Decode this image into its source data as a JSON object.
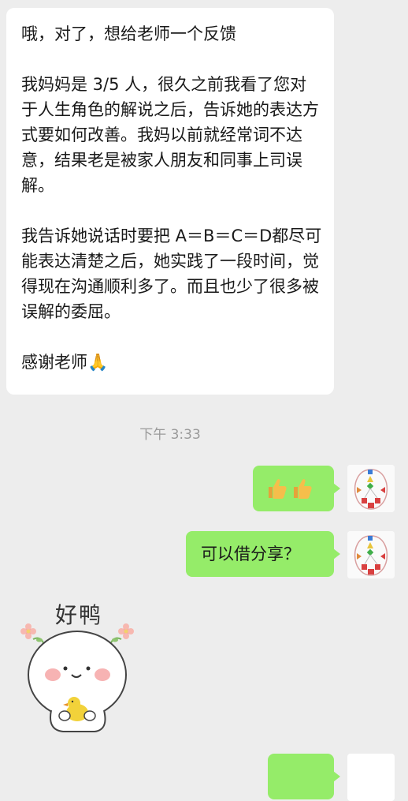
{
  "incoming_message": {
    "line1": "哦，对了，想给老师一个反馈",
    "para2": "我妈妈是 3/5 人，很久之前我看了您对于人生角色的解说之后，告诉她的表达方式要如何改善。我妈以前就经常词不达意，结果老是被家人朋友和同事上司误解。",
    "para3": "我告诉她说话时要把 A＝B＝C＝D都尽可能表达清楚之后，她实践了一段时间，觉得现在沟通顺利多了。而且也少了很多被误解的委屈。",
    "para4": "感谢老师",
    "emoji": "🙏"
  },
  "timestamp": "下午 3:33",
  "outgoing_messages": [
    {
      "type": "emoji",
      "content": "👍👍"
    },
    {
      "type": "text",
      "content": "可以借分享？"
    }
  ],
  "sticker": {
    "text": "好鸭"
  }
}
